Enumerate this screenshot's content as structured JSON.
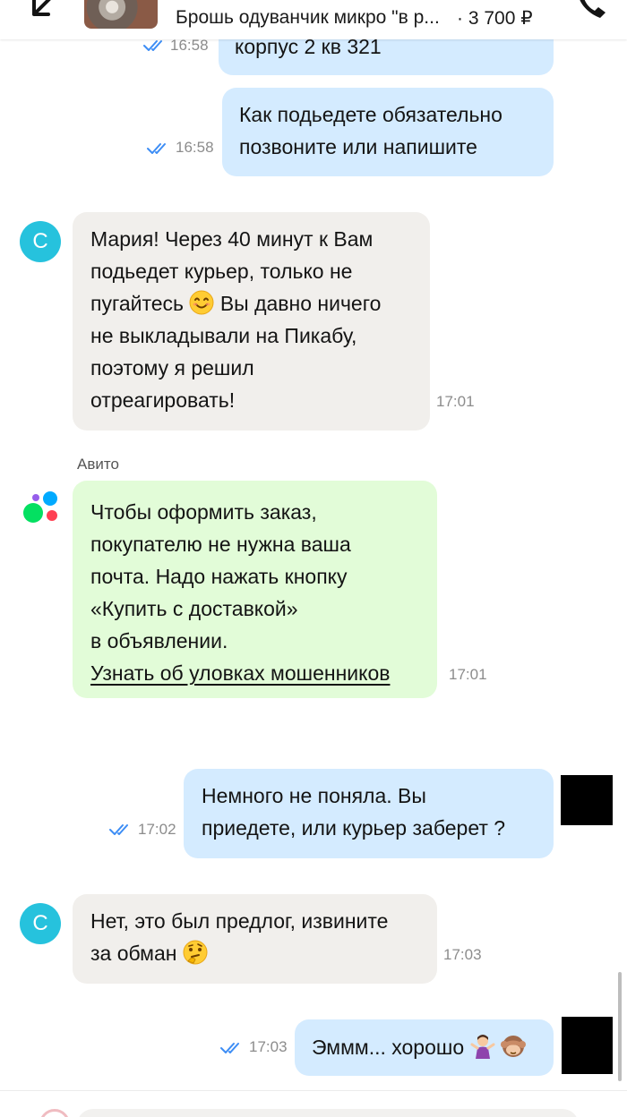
{
  "header": {
    "back_icon": "arrow-left-icon",
    "product_title": "Брошь одуванчик микро \"в р...",
    "product_price": "· 3 700 ₽",
    "call_icon": "phone-icon"
  },
  "messages": [
    {
      "direction": "out",
      "text": "корпус 2 кв 321",
      "time": "16:58",
      "status": "read"
    },
    {
      "direction": "out",
      "text": "Как подьедете обязательно\nпозвоните или напишите",
      "time": "16:58",
      "status": "read"
    },
    {
      "direction": "in",
      "avatar": "С",
      "text_lines": [
        "Мария! Через 40 минут к Вам",
        "подьедет курьер, только не",
        "пугайтесь",
        "Вы давно ничего",
        "не выкладывали на Пикабу,",
        "поэтому я решил",
        "отреагировать!"
      ],
      "emoji": "smiling-face-emoji",
      "time": "17:01"
    },
    {
      "direction": "system",
      "sender": "Авито",
      "text": "Чтобы оформить заказ,\nпокупателю не нужна ваша\nпочта. Надо нажать кнопку\n«Купить с доставкой»\nв объявлении.",
      "link": "Узнать об уловках мошенников",
      "time": "17:01"
    },
    {
      "direction": "out",
      "text": "Немного не поняла. Вы\nприедете, или курьер заберет ?",
      "time": "17:02",
      "status": "read"
    },
    {
      "direction": "in",
      "avatar": "С",
      "text_lines": [
        "Нет, это был предлог, извините",
        "за обман"
      ],
      "emoji": "thinking-face-emoji",
      "time": "17:03"
    },
    {
      "direction": "out",
      "text": "Эммм... хорошо",
      "emojis": [
        "woman-shrugging-emoji",
        "see-no-evil-monkey-emoji"
      ],
      "time": "17:03",
      "status": "read"
    }
  ],
  "colors": {
    "outgoing_bubble": "#d4ebff",
    "incoming_bubble": "#f1efec",
    "system_bubble": "#e2fcd8",
    "avatar": "#26c2dd",
    "read_tick": "#3d8df5"
  }
}
